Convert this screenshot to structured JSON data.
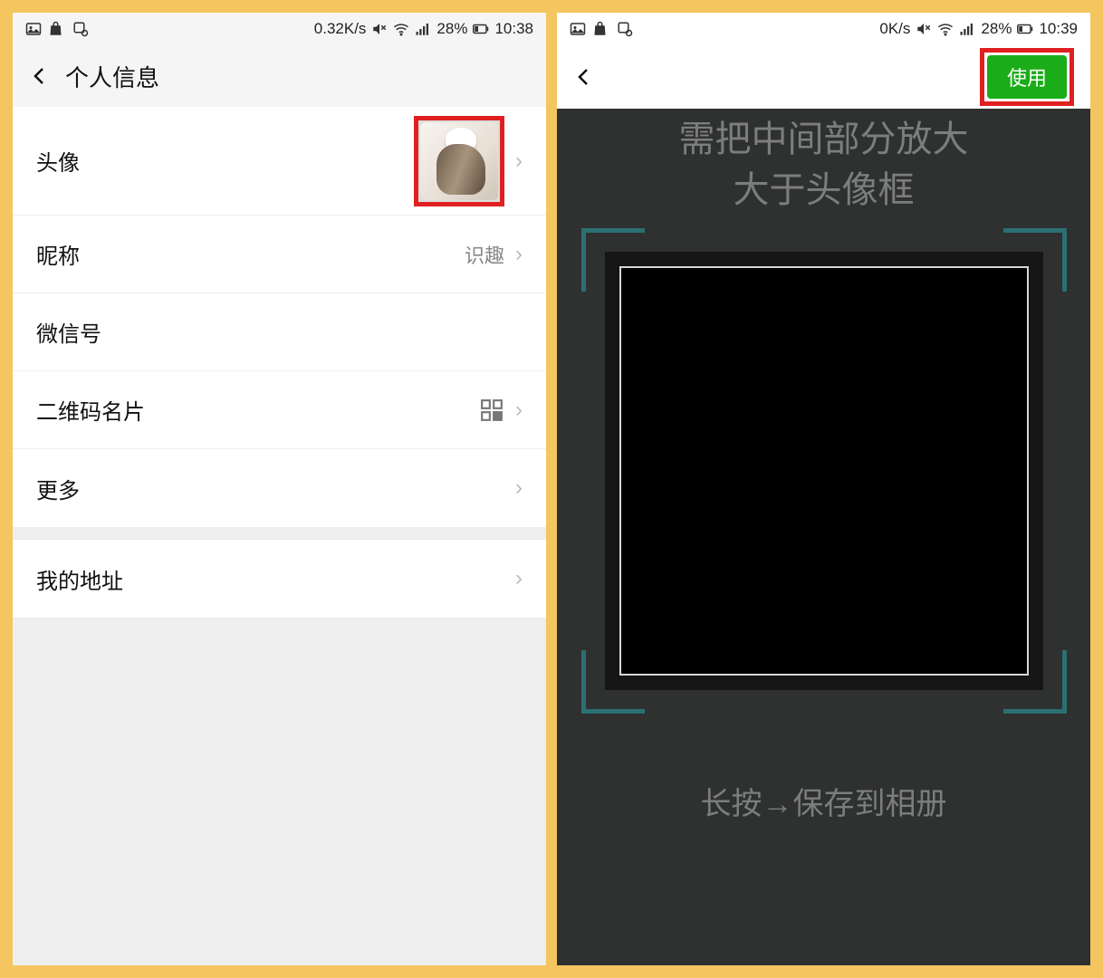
{
  "left": {
    "status": {
      "speed": "0.32K/s",
      "battery_pct": "28%",
      "time": "10:38"
    },
    "nav_title": "个人信息",
    "rows": {
      "avatar_label": "头像",
      "nickname_label": "昵称",
      "nickname_value": "识趣",
      "wechatid_label": "微信号",
      "qrcode_label": "二维码名片",
      "more_label": "更多",
      "address_label": "我的地址"
    }
  },
  "right": {
    "status": {
      "speed": "0K/s",
      "battery_pct": "28%",
      "time": "10:39"
    },
    "use_button": "使用",
    "hint_line1": "需把中间部分放大",
    "hint_line2": "大于头像框",
    "bottom_hint": "长按→保存到相册"
  },
  "colors": {
    "highlight_red": "#e02020",
    "button_green": "#1aad19",
    "corner_teal": "#2b7072"
  }
}
